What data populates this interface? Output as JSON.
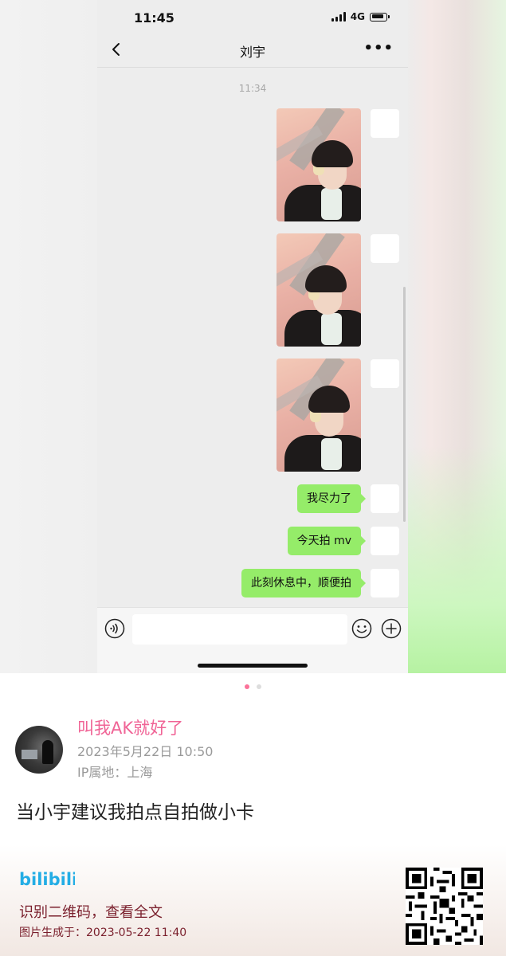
{
  "status_bar": {
    "time": "11:45",
    "network": "4G"
  },
  "chat": {
    "title": "刘宇",
    "timestamp": "11:34",
    "messages": [
      {
        "type": "image",
        "icon": "selfie-photo"
      },
      {
        "type": "image",
        "icon": "selfie-photo"
      },
      {
        "type": "image",
        "icon": "selfie-photo"
      },
      {
        "type": "text",
        "text": "我尽力了"
      },
      {
        "type": "text",
        "text": "今天拍 mv"
      },
      {
        "type": "text",
        "text": "此刻休息中，顺便拍"
      }
    ]
  },
  "input_bar": {
    "voice_icon": "voice-icon",
    "emoji_icon": "emoji-icon",
    "plus_icon": "plus-icon"
  },
  "carousel": {
    "count": 2,
    "active": 1
  },
  "post": {
    "username": "叫我AK就好了",
    "date": "2023年5月22日 10:50",
    "ip": "IP属地：上海",
    "content": "当小宇建议我拍点自拍做小卡"
  },
  "footer": {
    "brand": "bilibili",
    "scan_text": "识别二维码，查看全文",
    "generated": "图片生成于：2023-05-22 11:40"
  },
  "colors": {
    "bubble_green": "#95ec69",
    "username_pink": "#f06496",
    "footer_text": "#7a1f2c",
    "bili_blue": "#23ade5"
  }
}
